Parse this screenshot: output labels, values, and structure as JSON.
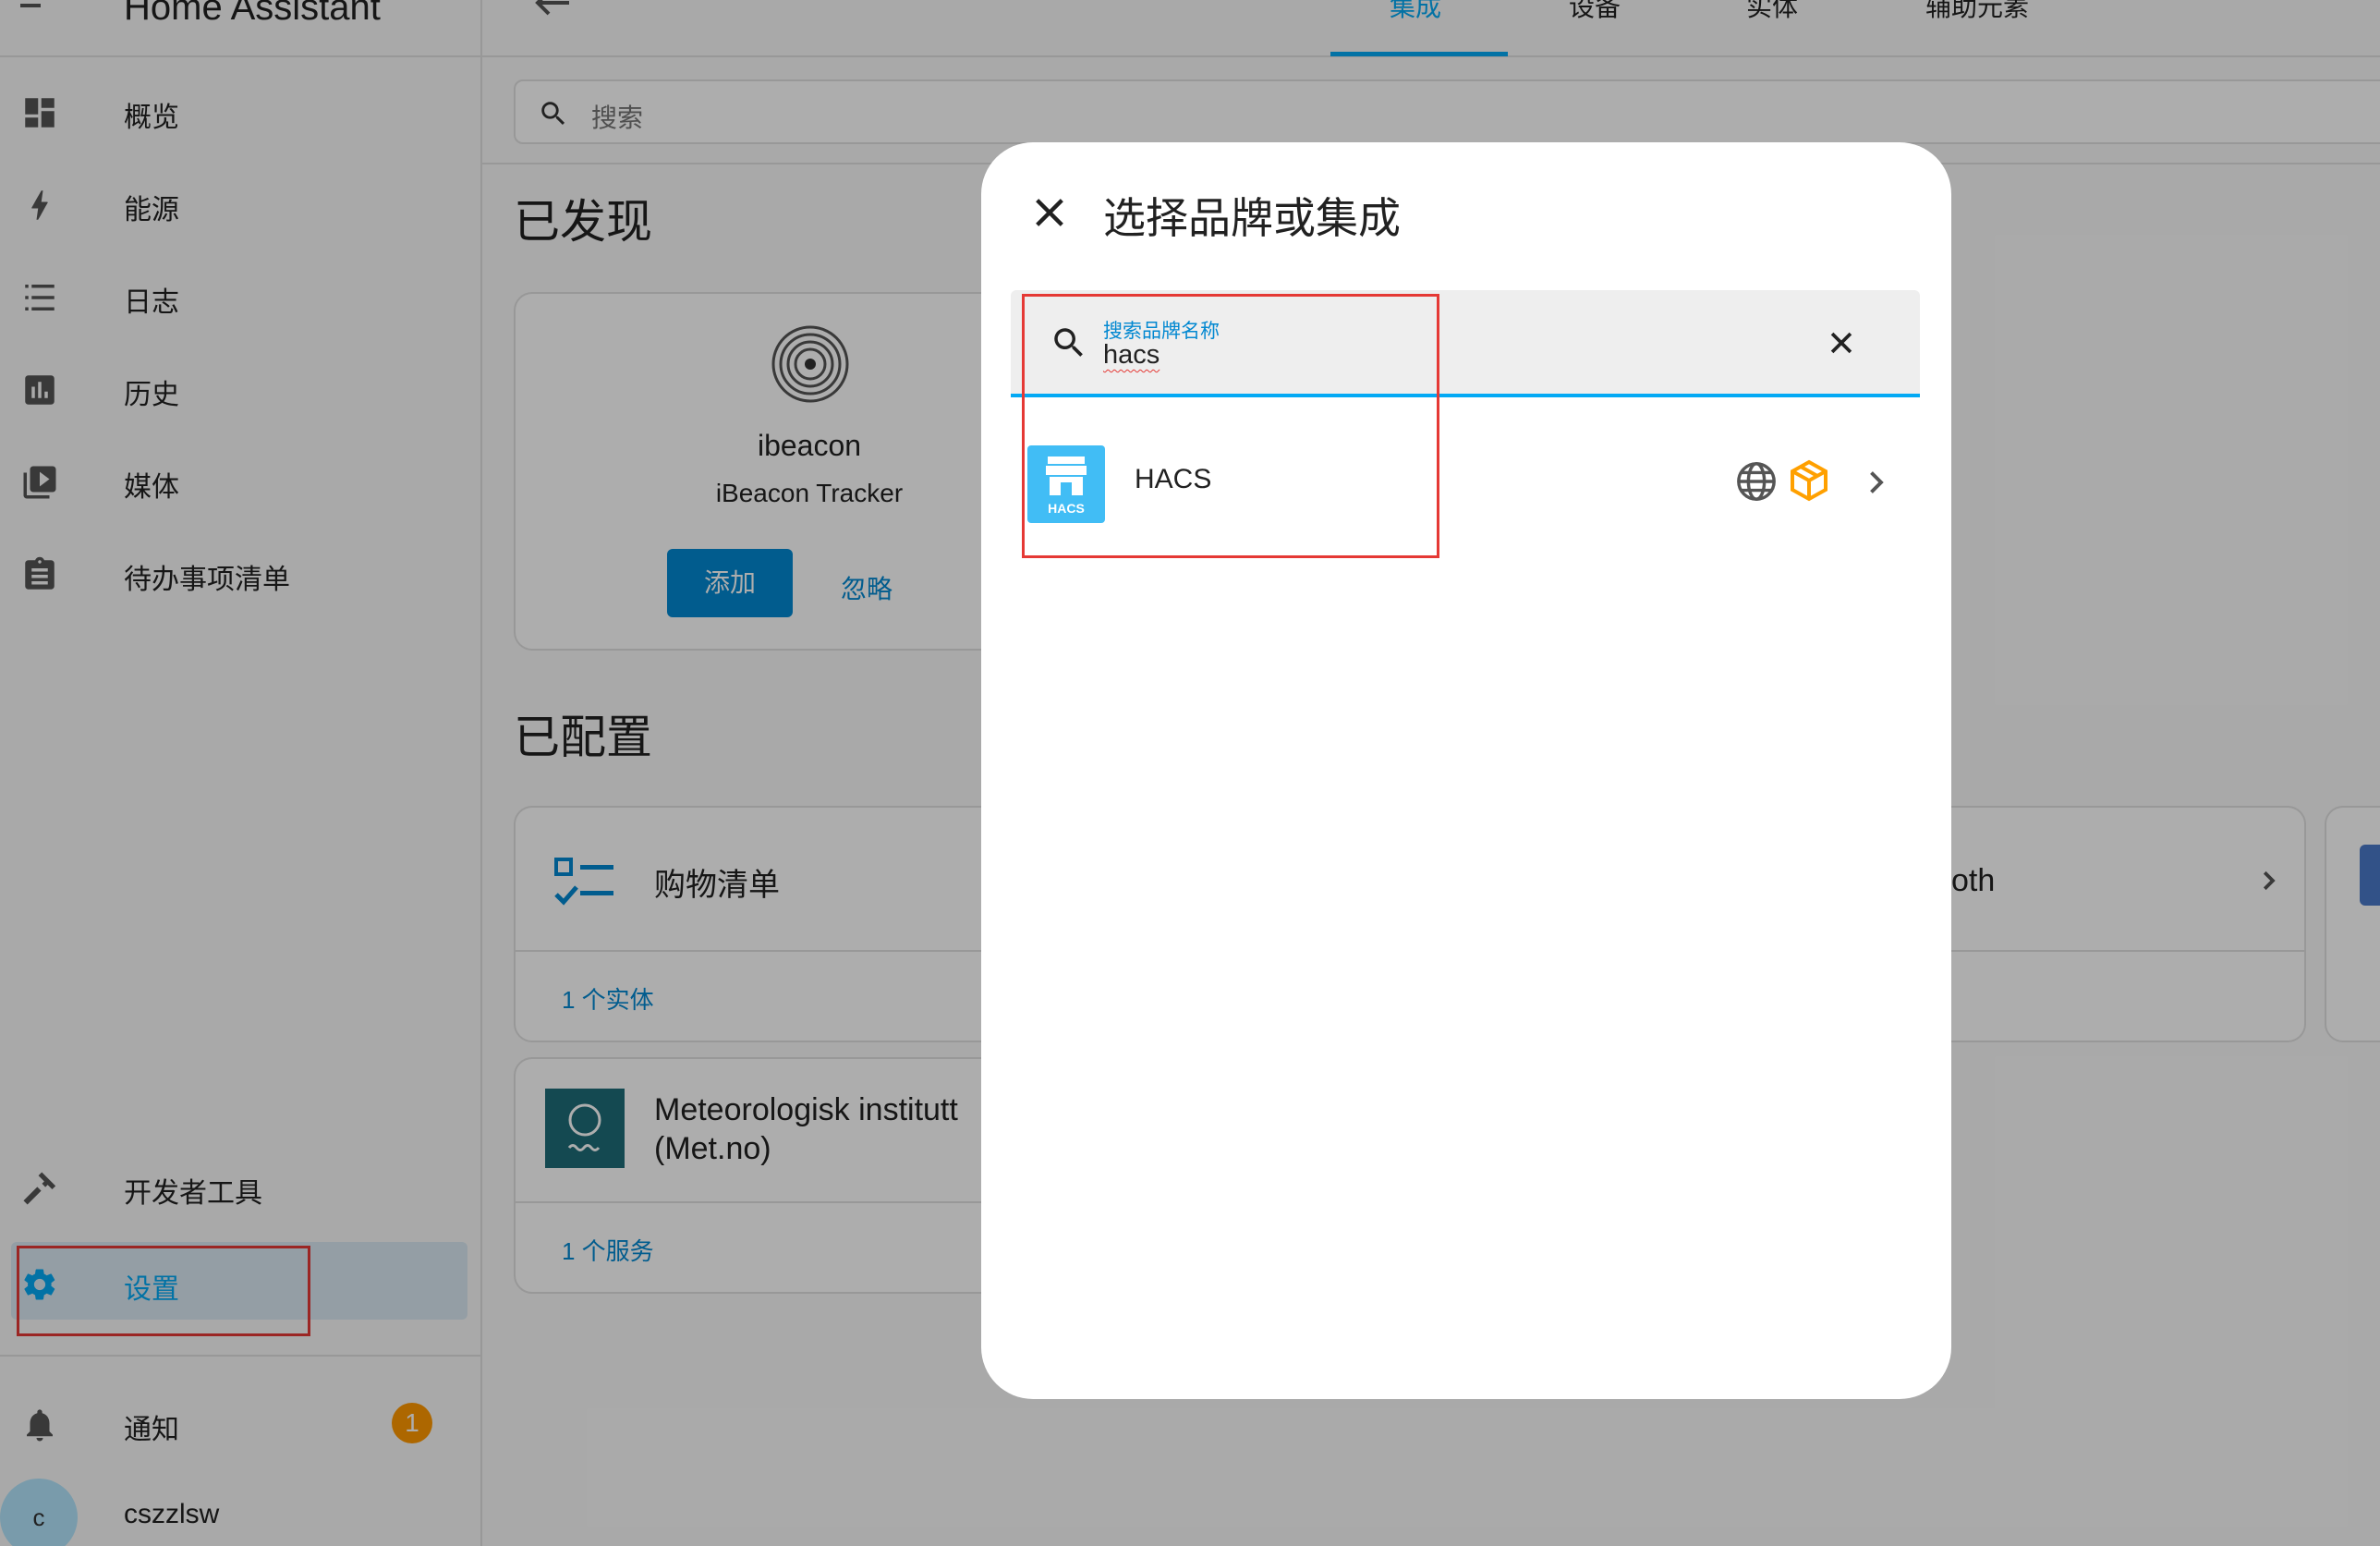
{
  "app_title": "Home Assistant",
  "sidebar": {
    "items": [
      {
        "label": "概览",
        "icon": "dashboard-icon"
      },
      {
        "label": "能源",
        "icon": "lightning-icon"
      },
      {
        "label": "日志",
        "icon": "list-icon"
      },
      {
        "label": "历史",
        "icon": "chart-icon"
      },
      {
        "label": "媒体",
        "icon": "media-icon"
      },
      {
        "label": "待办事项清单",
        "icon": "clipboard-icon"
      }
    ],
    "developer_tools": "开发者工具",
    "settings": "设置",
    "notifications": "通知",
    "notification_count": "1",
    "user_initial": "c",
    "user_name": "cszzlsw"
  },
  "tabs": [
    "集成",
    "设备",
    "实体",
    "辅助元素"
  ],
  "search_placeholder": "搜索",
  "discovered": {
    "section_title": "已发现",
    "name": "ibeacon",
    "subtitle": "iBeacon Tracker",
    "add_label": "添加",
    "ignore_label": "忽略"
  },
  "configured": {
    "section_title": "已配置",
    "cards": [
      {
        "title": "购物清单",
        "footer": "1 个实体"
      },
      {
        "title": "Meteorologisk institutt (Met.no)",
        "footer": "1 个服务"
      }
    ],
    "partial_card_title": "oth"
  },
  "dialog": {
    "title": "选择品牌或集成",
    "search_label": "搜索品牌名称",
    "search_value": "hacs",
    "result_name": "HACS",
    "result_logo_text": "HACS"
  },
  "colors": {
    "accent": "#03a9f4",
    "primary_button": "#0288d1",
    "badge": "#ff9800",
    "annotation": "#e53935"
  }
}
